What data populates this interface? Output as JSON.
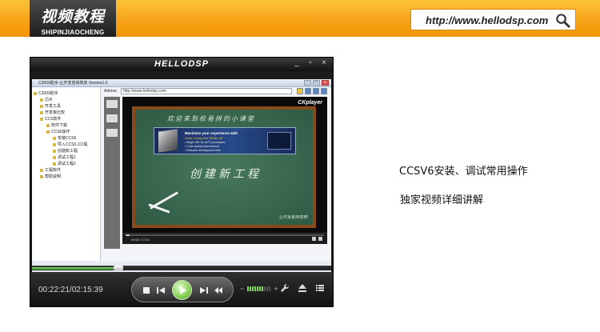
{
  "header": {
    "logo_main": "视频教程",
    "logo_sub": "SHIPINJIAOCHENG",
    "url": "http://www.hellodsp.com"
  },
  "player": {
    "title": "HELLODSP",
    "window_buttons": [
      "▫",
      "×"
    ],
    "time": "00:22:21/02:15:39",
    "progress": 0.29,
    "volume_level": 0.7
  },
  "screen": {
    "app_title": "C2000助手-让开发变得简单 Version1.0",
    "tree_items": [
      "C2000助手",
      "芯片",
      "开发工具",
      "开发板比较",
      "CCS软件",
      "软件下载",
      "CCS6操作",
      "安装CCS6",
      "导入CCS3.3工程",
      "创建新工程",
      "调试工程1",
      "调试工程2",
      "工程软件",
      "帮助说明"
    ],
    "address_label": "Adress:",
    "address": "http://www.hellodsp.com",
    "video_brand": "CKplayer",
    "chalk_top": "欢迎来到校易拼的小课堂",
    "banner_line1": "Maximize your experience with",
    "banner_line2": "Code Composer Studio v5",
    "banner_bullets": [
      "• Single IDE for all TI processors",
      "• Code quality improvement",
      "• Reduced development time"
    ],
    "chalk_big": "创建新工程",
    "chalk_sig": "让开发变得简单!",
    "video_time": "00:00 / 17:11",
    "video_progress": 0.02
  },
  "side": {
    "title": "CCSV6安装、调试常用操作",
    "subtitle": "独家视频详细讲解"
  },
  "colors": {
    "header_orange": "#f7a419",
    "play_green": "#8bd45b"
  }
}
